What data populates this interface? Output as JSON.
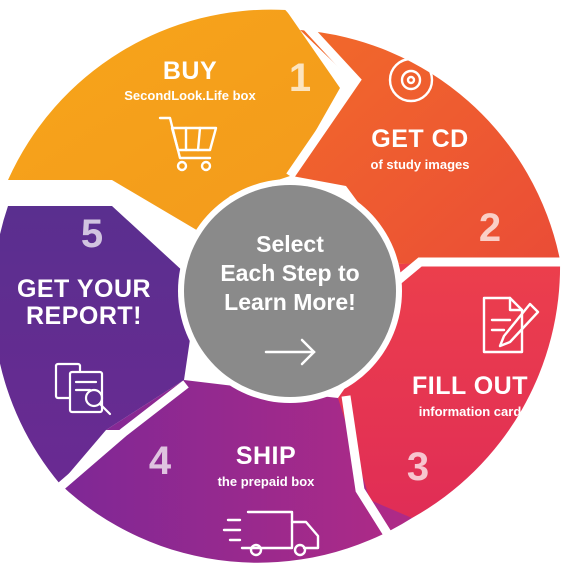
{
  "center": {
    "text": "Select\nEach Step to\nLearn More!",
    "arrow_icon": "arrow-right-icon"
  },
  "steps": [
    {
      "number": "1",
      "title": "BUY",
      "subtitle": "SecondLook.Life box",
      "icon": "shopping-cart-icon",
      "color": "#f5a11a"
    },
    {
      "number": "2",
      "title": "GET CD",
      "subtitle": "of study images",
      "icon": "cd-disc-icon",
      "color": "#ee5a2f"
    },
    {
      "number": "3",
      "title": "FILL OUT",
      "subtitle": "information card",
      "icon": "document-pen-icon",
      "color": "#e8344f"
    },
    {
      "number": "4",
      "title": "SHIP",
      "subtitle": "the prepaid box",
      "icon": "delivery-truck-icon",
      "color": "#9c2a8a"
    },
    {
      "number": "5",
      "title": "GET YOUR\nREPORT!",
      "subtitle": "",
      "icon": "report-search-icon",
      "color": "#5c2d91"
    }
  ],
  "colors": {
    "center_circle": "#8a8a8a",
    "ring_gap": "#ffffff"
  }
}
